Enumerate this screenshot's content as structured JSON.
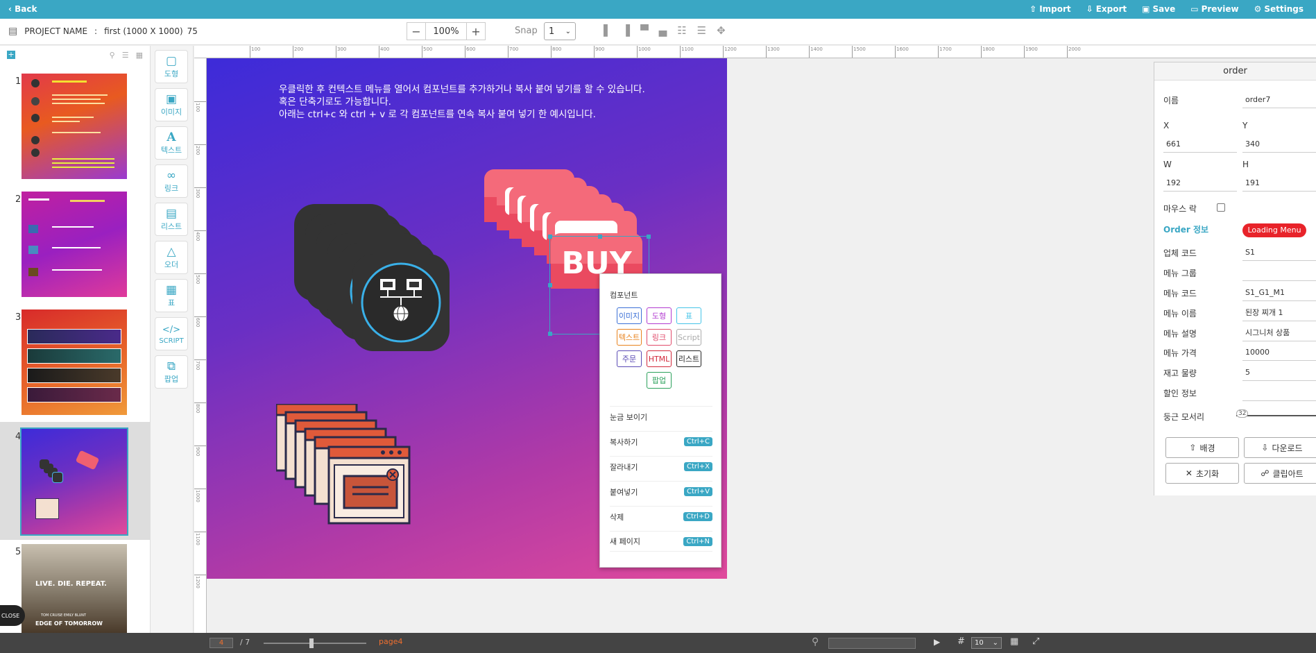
{
  "topbar": {
    "back": "Back",
    "import": "Import",
    "export": "Export",
    "save": "Save",
    "preview": "Preview",
    "settings": "Settings"
  },
  "toolbar": {
    "project_label": "PROJECT NAME",
    "project_value": "first (1000 X 1000)",
    "project_extra": "75",
    "zoom": "100%",
    "snap_label": "Snap",
    "snap_value": "1"
  },
  "pages": [
    {
      "num": "1"
    },
    {
      "num": "2"
    },
    {
      "num": "3"
    },
    {
      "num": "4",
      "selected": true
    },
    {
      "num": "5"
    }
  ],
  "page5_texts": {
    "tagline": "LIVE. DIE. REPEAT.",
    "actors": "TOM CRUISE   EMILY BLUNT",
    "title": "EDGE OF TOMORROW"
  },
  "close_label": "CLOSE",
  "tools": [
    {
      "label": "도형",
      "icon": "rectangle-icon"
    },
    {
      "label": "이미지",
      "icon": "image-icon"
    },
    {
      "label": "텍스트",
      "icon": "text-icon"
    },
    {
      "label": "링크",
      "icon": "link-icon"
    },
    {
      "label": "리스트",
      "icon": "list-icon"
    },
    {
      "label": "오더",
      "icon": "cart-icon"
    },
    {
      "label": "표",
      "icon": "table-icon"
    },
    {
      "label": "SCRIPT",
      "icon": "code-icon"
    },
    {
      "label": "팝업",
      "icon": "popup-icon"
    }
  ],
  "ruler": {
    "top": [
      "100",
      "200",
      "300",
      "400",
      "500",
      "600",
      "700",
      "800",
      "900",
      "1000",
      "1100",
      "1200",
      "1300",
      "1400",
      "1500",
      "1600",
      "1700",
      "1800",
      "1900",
      "2000"
    ],
    "left": [
      "100",
      "200",
      "300",
      "400",
      "500",
      "600",
      "700",
      "800",
      "900",
      "1000",
      "1100",
      "1200"
    ]
  },
  "canvas": {
    "line1": "우클릭한 후 컨텍스트 메뉴를 열어서 컴포넌트를 추가하거나 복사 붙여 넣기를 할 수 있습니다.",
    "line2": "혹은 단축기로도 가능합니다.",
    "line3": "아래는 ctrl+c 와 ctrl + v 로 각 컴포넌트를 연속 복사 붙여 넣기 한 예시입니다.",
    "buy": "BUY"
  },
  "context_menu": {
    "title": "컴포넌트",
    "buttons": [
      {
        "label": "이미지",
        "color": "#3b6fd6"
      },
      {
        "label": "도형",
        "color": "#b23ad0"
      },
      {
        "label": "표",
        "color": "#44c4e8"
      },
      {
        "label": "텍스트",
        "color": "#e8821c"
      },
      {
        "label": "링크",
        "color": "#e04a6a"
      },
      {
        "label": "Script",
        "color": "#aaaaaa"
      },
      {
        "label": "주문",
        "color": "#5a4ab5"
      },
      {
        "label": "HTML",
        "color": "#d2283a"
      },
      {
        "label": "리스트",
        "color": "#222222"
      },
      {
        "label": "팝업",
        "color": "#2aa05a"
      }
    ],
    "items": [
      {
        "label": "눈금 보이기",
        "shortcut": ""
      },
      {
        "label": "복사하기",
        "shortcut": "Ctrl+C"
      },
      {
        "label": "잘라내기",
        "shortcut": "Ctrl+X"
      },
      {
        "label": "붙여넣기",
        "shortcut": "Ctrl+V"
      },
      {
        "label": "삭제",
        "shortcut": "Ctrl+D"
      },
      {
        "label": "새 페이지",
        "shortcut": "Ctrl+N"
      }
    ]
  },
  "props": {
    "header": "order",
    "name_label": "이름",
    "name_value": "order7",
    "x_label": "X",
    "y_label": "Y",
    "x_value": "661",
    "y_value": "340",
    "w_label": "W",
    "h_label": "H",
    "w_value": "192",
    "h_value": "191",
    "mouse_lock": "마우스 락",
    "order_info": "Order 정보",
    "loading_menu": "Loading Menu",
    "fields": [
      {
        "label": "업체 코드",
        "value": "S1"
      },
      {
        "label": "메뉴 그룹",
        "value": ""
      },
      {
        "label": "메뉴 코드",
        "value": "S1_G1_M1"
      },
      {
        "label": "메뉴 이름",
        "value": "된장 찌개 1"
      },
      {
        "label": "메뉴 설명",
        "value": "시그니처 상품"
      },
      {
        "label": "메뉴 가격",
        "value": "10000"
      },
      {
        "label": "재고 물량",
        "value": "5"
      },
      {
        "label": "할인 정보",
        "value": ""
      }
    ],
    "radius_label": "둥근 모서리",
    "radius_value": "32",
    "btn_bg": "배경",
    "btn_download": "다운로드",
    "btn_reset": "초기화",
    "btn_clipart": "클립아트"
  },
  "bottom": {
    "page_input": "4",
    "page_total": "/ 7",
    "page_name": "page4",
    "grid_value": "10"
  },
  "colors": {
    "accent": "#3aa7c4",
    "loading_red": "#e8232a"
  }
}
